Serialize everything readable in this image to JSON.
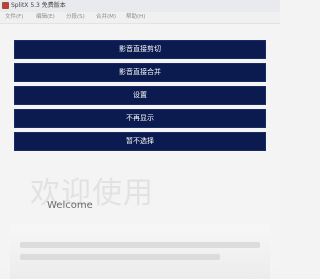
{
  "window": {
    "title": "SplitX 5.3 免费版本"
  },
  "menu": [
    "文件(F)",
    "编辑(E)",
    "分段(S)",
    "合并(M)",
    "帮助(H)"
  ],
  "overlay_buttons": [
    {
      "label": "影音直接剪切"
    },
    {
      "label": "影音直接合并"
    },
    {
      "label": "设置"
    },
    {
      "label": "不再显示"
    },
    {
      "label": "暂不选择"
    }
  ],
  "welcome": {
    "heading": "欢迎使用",
    "subheading": "Welcome"
  },
  "colors": {
    "button_bg": "#0b1b4f",
    "button_text": "#ffffff",
    "app_icon": "#b4453b"
  }
}
